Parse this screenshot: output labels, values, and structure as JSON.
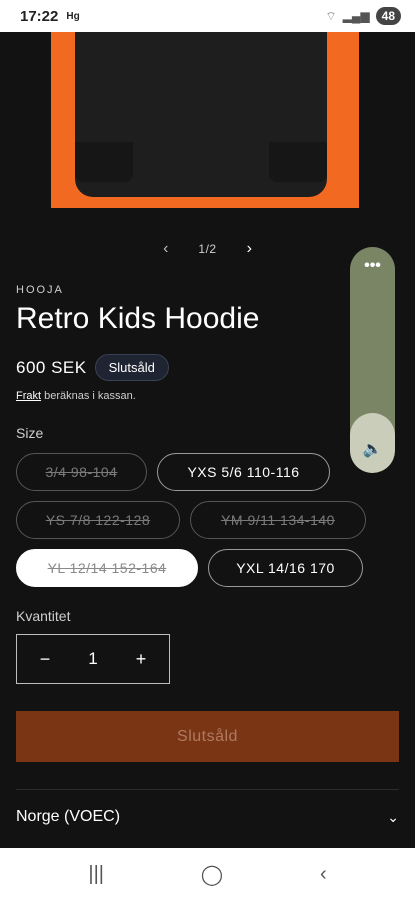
{
  "status_bar": {
    "time": "17:22",
    "carrier_icon": "Hg",
    "battery": "48"
  },
  "gallery": {
    "counter": "1/2",
    "prev_icon": "chevron-left",
    "next_icon": "chevron-right"
  },
  "product": {
    "vendor": "HOOJA",
    "title": "Retro Kids Hoodie",
    "price": "600 SEK",
    "badge": "Slutsåld",
    "shipping_link": "Frakt",
    "shipping_text": " beräknas i kassan."
  },
  "size": {
    "label": "Size",
    "options": [
      {
        "label": "3/4 98-104",
        "state": "soldout"
      },
      {
        "label": "YXS 5/6 110-116",
        "state": "available"
      },
      {
        "label": "YS 7/8 122-128",
        "state": "soldout"
      },
      {
        "label": "YM 9/11 134-140",
        "state": "soldout"
      },
      {
        "label": "YL 12/14 152-164",
        "state": "selected-soldout"
      },
      {
        "label": "YXL 14/16 170",
        "state": "available"
      }
    ]
  },
  "quantity": {
    "label": "Kvantitet",
    "value": "1",
    "minus": "−",
    "plus": "+"
  },
  "buy_button": {
    "label": "Slutsåld"
  },
  "region": {
    "label": "Norge (VOEC)"
  },
  "volume_overlay": {
    "menu": "•••",
    "icon": "speaker-icon"
  },
  "colors": {
    "background": "#121212",
    "accent": "#7a3515",
    "image_bg": "#f26a22"
  }
}
